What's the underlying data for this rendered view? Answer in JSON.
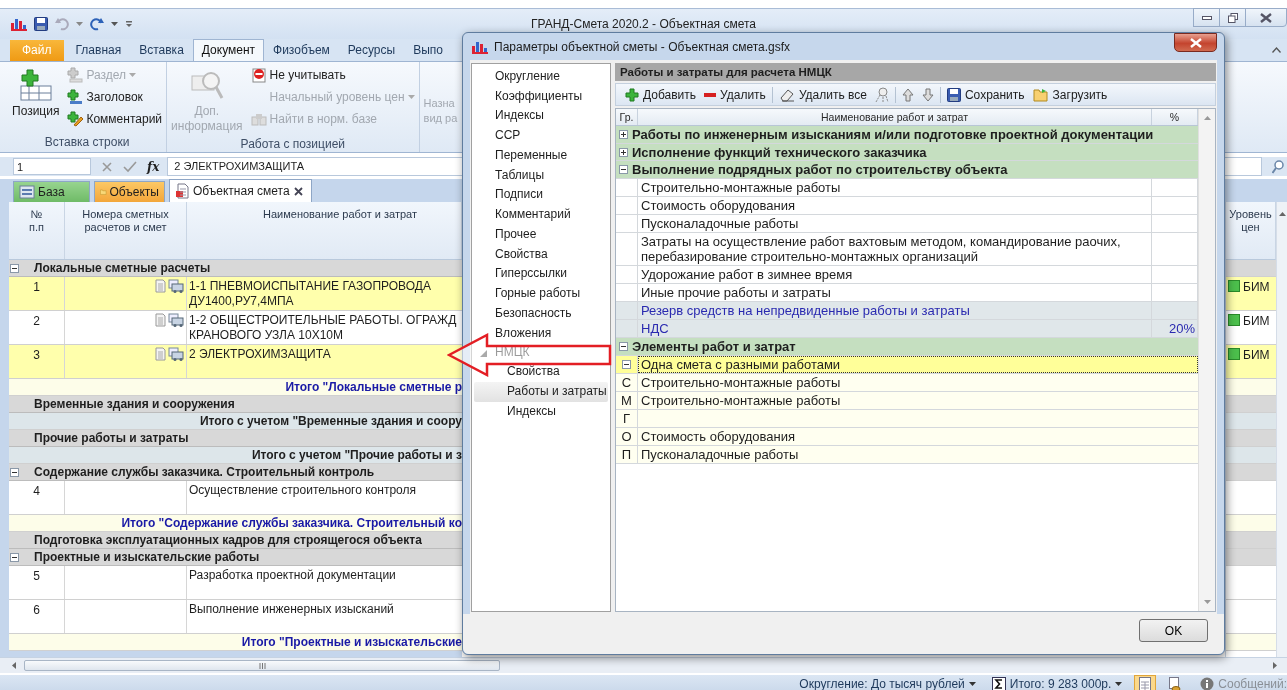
{
  "window": {
    "title": "ГРАНД-Смета 2020.2 - Объектная смета"
  },
  "ribbon": {
    "tabs": [
      {
        "label": "Файл",
        "kind": "file",
        "selected": false
      },
      {
        "label": "Главная",
        "kind": "tab",
        "selected": false
      },
      {
        "label": "Вставка",
        "kind": "tab",
        "selected": false
      },
      {
        "label": "Документ",
        "kind": "tab",
        "selected": true
      },
      {
        "label": "Физобъем",
        "kind": "tab",
        "selected": false
      },
      {
        "label": "Ресурсы",
        "kind": "tab",
        "selected": false
      },
      {
        "label": "Выпо",
        "kind": "tab",
        "selected": false
      }
    ],
    "groups": [
      {
        "title": "Вставка строки",
        "big": {
          "label": "Позиция",
          "kind": "position",
          "disabled": false
        },
        "items": [
          {
            "label": "Раздел",
            "kind": "section",
            "disabled": true,
            "dropdown": true
          },
          {
            "label": "Заголовок",
            "kind": "heading",
            "disabled": false,
            "dropdown": false
          },
          {
            "label": "Комментарий",
            "kind": "comment",
            "disabled": false,
            "dropdown": false
          }
        ]
      },
      {
        "title": "Работа с позицией",
        "big": {
          "label": "Доп.\nинформация",
          "kind": "info",
          "disabled": true
        },
        "items": [
          {
            "label": "Не учитывать",
            "kind": "exclude",
            "disabled": false,
            "dropdown": false
          },
          {
            "label": "Начальный уровень цен",
            "kind": "none",
            "disabled": true,
            "dropdown": true
          },
          {
            "label": "Найти в норм. базе",
            "kind": "find",
            "disabled": true,
            "dropdown": false
          }
        ]
      }
    ],
    "partial_button": {
      "label": "Назна\nвид ра",
      "disabled": true
    }
  },
  "formula_bar": {
    "cell": "1",
    "function_label": "fx",
    "value": "2 ЭЛЕКТРОХИМЗАЩИТА"
  },
  "doc_tabs": [
    {
      "label": "База",
      "kind": "base",
      "selected": false
    },
    {
      "label": "Объекты",
      "kind": "objects",
      "selected": false
    },
    {
      "label": "Объектная смета",
      "kind": "document",
      "selected": true
    }
  ],
  "sheet": {
    "columns": [
      "№\nп.п",
      "Номера сметных\nрасчетов и смет",
      "Наименование работ и затрат",
      "Уровень\nцен"
    ],
    "rows": [
      {
        "kind": "section",
        "title": "Локальные сметные расчеты",
        "expanded": true
      },
      {
        "kind": "position",
        "number": "1",
        "name": "1-1 ПНЕВМОИСПЫТАНИЕ ГАЗОПРОВОДА\nДУ1400,РУ7,4МПА",
        "highlighted": true,
        "price_level": "БИМ"
      },
      {
        "kind": "position",
        "number": "2",
        "name": "1-2 ОБЩЕСТРОИТЕЛЬНЫЕ РАБОТЫ. ОГРАЖД\nКРАНОВОГО УЗЛА 10Х10М",
        "highlighted": false,
        "price_level": "БИМ"
      },
      {
        "kind": "position",
        "number": "3",
        "name": "2 ЭЛЕКТРОХИМЗАЩИТА",
        "highlighted": true,
        "price_level": "БИМ"
      },
      {
        "kind": "total",
        "title": "Итого \"Локальные сметные р"
      },
      {
        "kind": "section",
        "title": "Временные здания и сооружения"
      },
      {
        "kind": "total_with",
        "title": "Итого с учетом \"Временные здания и соору"
      },
      {
        "kind": "section",
        "title": "Прочие работы и затраты"
      },
      {
        "kind": "total_with",
        "title": "Итого с учетом \"Прочие работы и з"
      },
      {
        "kind": "section",
        "title": "Содержание службы заказчика. Строительный контроль",
        "expanded": true
      },
      {
        "kind": "position",
        "number": "4",
        "name": "Осуществление строительного контроля",
        "highlighted": false
      },
      {
        "kind": "total",
        "title": "Итого \"Содержание службы заказчика. Строительный ко"
      },
      {
        "kind": "section",
        "title": "Подготовка эксплуатационных кадров для строящегося объекта"
      },
      {
        "kind": "section",
        "title": "Проектные и изыскательские работы",
        "expanded": true
      },
      {
        "kind": "position",
        "number": "5",
        "name": "Разработка проектной документации",
        "highlighted": false
      },
      {
        "kind": "position",
        "number": "6",
        "name": "Выполнение инженерных изысканий",
        "highlighted": false
      },
      {
        "kind": "total",
        "title": "Итого \"Проектные и изыскательские"
      }
    ]
  },
  "status_bar": {
    "rounding": "Округление: До тысяч рублей",
    "total": "Итого: 9 283 000р.",
    "views": [
      {
        "kind": "sheet",
        "selected": true
      },
      {
        "kind": "objects",
        "selected": false
      }
    ],
    "messages": "Сообщений:"
  },
  "dialog": {
    "title": "Параметры объектной сметы - Объектная смета.gsfx",
    "nav": [
      {
        "label": "Округление",
        "selected": false
      },
      {
        "label": "Коэффициенты",
        "selected": false
      },
      {
        "label": "Индексы",
        "selected": false
      },
      {
        "label": "ССР",
        "selected": false
      },
      {
        "label": "Переменные",
        "selected": false
      },
      {
        "label": "Таблицы",
        "selected": false
      },
      {
        "label": "Подписи",
        "selected": false
      },
      {
        "label": "Комментарий",
        "selected": false
      },
      {
        "label": "Прочее",
        "selected": false
      },
      {
        "label": "Свойства",
        "selected": false
      },
      {
        "label": "Гиперссылки",
        "selected": false
      },
      {
        "label": "Горные работы",
        "selected": false
      },
      {
        "label": "Безопасность",
        "selected": false
      },
      {
        "label": "Вложения",
        "selected": false
      },
      {
        "label": "НМЦК",
        "selected": false,
        "expanded": true,
        "children": [
          {
            "label": "Свойства",
            "selected": false
          },
          {
            "label": "Работы и затраты",
            "selected": true
          },
          {
            "label": "Индексы",
            "selected": false
          }
        ]
      }
    ],
    "panel_title": "Работы и затраты для расчета НМЦК",
    "toolbar": [
      {
        "kind": "add",
        "label": "Добавить"
      },
      {
        "kind": "remove",
        "label": "Удалить"
      },
      {
        "kind": "sep"
      },
      {
        "kind": "clear",
        "label": "Удалить все"
      },
      {
        "kind": "tool"
      },
      {
        "kind": "sep"
      },
      {
        "kind": "up"
      },
      {
        "kind": "down"
      },
      {
        "kind": "sep"
      },
      {
        "kind": "save",
        "label": "Сохранить"
      },
      {
        "kind": "load",
        "label": "Загрузить"
      }
    ],
    "grid": {
      "columns": [
        "Гр.",
        "Наименование работ и затрат",
        "%"
      ],
      "groups": [
        {
          "name": "Работы по инженерным изысканиям и/или подготовке проектной документации",
          "expanded": false,
          "selected": false
        },
        {
          "name": "Исполнение функций технического заказчика",
          "expanded": false,
          "selected": false
        },
        {
          "name": "Выполнение подрядных работ по строительству объекта",
          "expanded": true,
          "selected": false,
          "children": [
            {
              "kind": "item",
              "name": "Строительно-монтажные работы",
              "selected": false
            },
            {
              "kind": "item",
              "name": "Стоимость оборудования",
              "selected": false
            },
            {
              "kind": "item",
              "name": "Пусконаладочные работы",
              "selected": false
            },
            {
              "kind": "item",
              "name": "Затраты на осуществление работ вахтовым методом, командирование раочих, перебазирование строительно-монтажных организаций",
              "selected": false
            },
            {
              "kind": "item",
              "name": "Удорожание работ в зимнее время",
              "selected": false
            },
            {
              "kind": "item",
              "name": "Иные прочие работы и затраты",
              "selected": false
            },
            {
              "kind": "reserve",
              "name": "Резерв средств на непредвиденные работы и затраты",
              "selected": false
            },
            {
              "kind": "reserve",
              "name": "НДС",
              "percent": "20%",
              "selected": false
            }
          ]
        },
        {
          "name": "Элементы работ и затрат",
          "expanded": true,
          "selected": false,
          "children": [
            {
              "kind": "element",
              "name": "Одна смета с разными работами",
              "expanded": true,
              "selected": true,
              "children": [
                {
                  "code": "С",
                  "name": "Строительно-монтажные работы",
                  "selected": false
                },
                {
                  "code": "М",
                  "name": "Строительно-монтажные работы",
                  "selected": false
                },
                {
                  "code": "Г",
                  "selected": false
                },
                {
                  "code": "О",
                  "name": "Стоимость оборудования",
                  "selected": false
                },
                {
                  "code": "П",
                  "name": "Пусконаладочные работы",
                  "selected": false
                }
              ]
            }
          ]
        }
      ]
    },
    "ok": "OK"
  }
}
